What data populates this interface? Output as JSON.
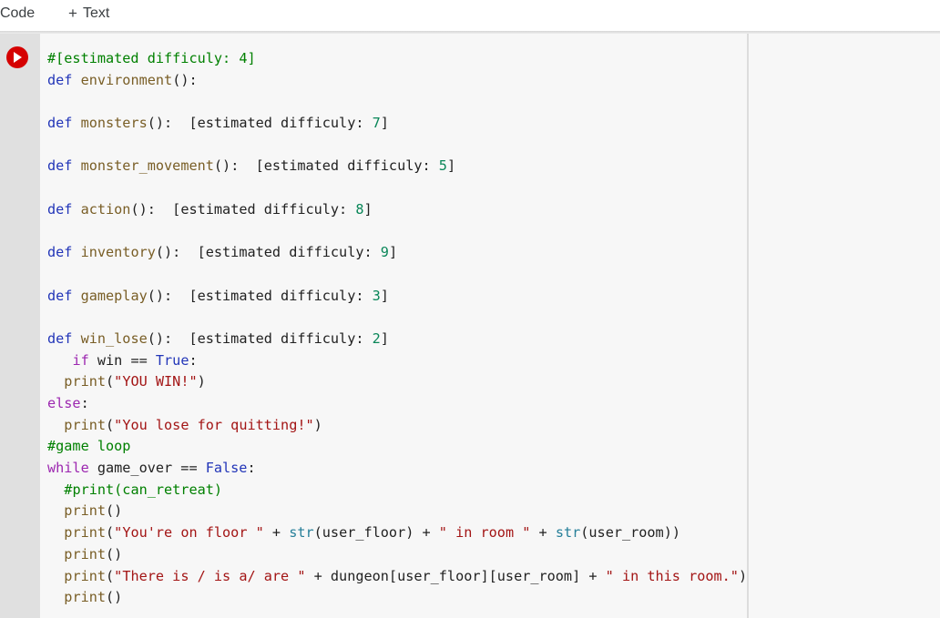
{
  "toolbar": {
    "code_label": "Code",
    "code_icon": "plus-icon",
    "text_label": "Text",
    "text_plus": "+",
    "code_plus": "+"
  },
  "cell": {
    "run_icon": "play-icon",
    "lines": [
      [
        {
          "t": "#[estimated difficuly: ",
          "c": "cm"
        },
        {
          "t": "4",
          "c": "cm"
        },
        {
          "t": "]",
          "c": "cm"
        }
      ],
      [
        {
          "t": "def",
          "c": "kw"
        },
        {
          "t": " ",
          "c": "pl"
        },
        {
          "t": "environment",
          "c": "fn"
        },
        {
          "t": "():",
          "c": "pl"
        }
      ],
      [],
      [
        {
          "t": "def",
          "c": "kw"
        },
        {
          "t": " ",
          "c": "pl"
        },
        {
          "t": "monsters",
          "c": "fn"
        },
        {
          "t": "():  [estimated difficuly: ",
          "c": "pl"
        },
        {
          "t": "7",
          "c": "num"
        },
        {
          "t": "]",
          "c": "pl"
        }
      ],
      [],
      [
        {
          "t": "def",
          "c": "kw"
        },
        {
          "t": " ",
          "c": "pl"
        },
        {
          "t": "monster_movement",
          "c": "fn"
        },
        {
          "t": "():  [estimated difficuly: ",
          "c": "pl"
        },
        {
          "t": "5",
          "c": "num"
        },
        {
          "t": "]",
          "c": "pl"
        }
      ],
      [],
      [
        {
          "t": "def",
          "c": "kw"
        },
        {
          "t": " ",
          "c": "pl"
        },
        {
          "t": "action",
          "c": "fn"
        },
        {
          "t": "():  [estimated difficuly: ",
          "c": "pl"
        },
        {
          "t": "8",
          "c": "num"
        },
        {
          "t": "]",
          "c": "pl"
        }
      ],
      [],
      [
        {
          "t": "def",
          "c": "kw"
        },
        {
          "t": " ",
          "c": "pl"
        },
        {
          "t": "inventory",
          "c": "fn"
        },
        {
          "t": "():  [estimated difficuly: ",
          "c": "pl"
        },
        {
          "t": "9",
          "c": "num"
        },
        {
          "t": "]",
          "c": "pl"
        }
      ],
      [],
      [
        {
          "t": "def",
          "c": "kw"
        },
        {
          "t": " ",
          "c": "pl"
        },
        {
          "t": "gameplay",
          "c": "fn"
        },
        {
          "t": "():  [estimated difficuly: ",
          "c": "pl"
        },
        {
          "t": "3",
          "c": "num"
        },
        {
          "t": "]",
          "c": "pl"
        }
      ],
      [],
      [
        {
          "t": "def",
          "c": "kw"
        },
        {
          "t": " ",
          "c": "pl"
        },
        {
          "t": "win_lose",
          "c": "fn"
        },
        {
          "t": "():  [estimated difficuly: ",
          "c": "pl"
        },
        {
          "t": "2",
          "c": "num"
        },
        {
          "t": "]",
          "c": "pl"
        }
      ],
      [
        {
          "t": "   ",
          "c": "pl"
        },
        {
          "t": "if",
          "c": "kw2"
        },
        {
          "t": " win == ",
          "c": "pl"
        },
        {
          "t": "True",
          "c": "kw"
        },
        {
          "t": ":",
          "c": "pl"
        }
      ],
      [
        {
          "t": "  ",
          "c": "pl"
        },
        {
          "t": "print",
          "c": "fn"
        },
        {
          "t": "(",
          "c": "pl"
        },
        {
          "t": "\"YOU WIN!\"",
          "c": "str"
        },
        {
          "t": ")",
          "c": "pl"
        }
      ],
      [
        {
          "t": "else",
          "c": "kw2"
        },
        {
          "t": ":",
          "c": "pl"
        }
      ],
      [
        {
          "t": "  ",
          "c": "pl"
        },
        {
          "t": "print",
          "c": "fn"
        },
        {
          "t": "(",
          "c": "pl"
        },
        {
          "t": "\"You lose for quitting!\"",
          "c": "str"
        },
        {
          "t": ")",
          "c": "pl"
        }
      ],
      [
        {
          "t": "#game loop",
          "c": "cm"
        }
      ],
      [
        {
          "t": "while",
          "c": "kw2"
        },
        {
          "t": " game_over == ",
          "c": "pl"
        },
        {
          "t": "False",
          "c": "kw"
        },
        {
          "t": ":",
          "c": "pl"
        }
      ],
      [
        {
          "t": "  ",
          "c": "pl"
        },
        {
          "t": "#print(can_retreat)",
          "c": "cm"
        }
      ],
      [
        {
          "t": "  ",
          "c": "pl"
        },
        {
          "t": "print",
          "c": "fn"
        },
        {
          "t": "()",
          "c": "pl"
        }
      ],
      [
        {
          "t": "  ",
          "c": "pl"
        },
        {
          "t": "print",
          "c": "fn"
        },
        {
          "t": "(",
          "c": "pl"
        },
        {
          "t": "\"You're on floor \"",
          "c": "str"
        },
        {
          "t": " + ",
          "c": "pl"
        },
        {
          "t": "str",
          "c": "bi"
        },
        {
          "t": "(user_floor) + ",
          "c": "pl"
        },
        {
          "t": "\" in room \"",
          "c": "str"
        },
        {
          "t": " + ",
          "c": "pl"
        },
        {
          "t": "str",
          "c": "bi"
        },
        {
          "t": "(user_room))",
          "c": "pl"
        }
      ],
      [
        {
          "t": "  ",
          "c": "pl"
        },
        {
          "t": "print",
          "c": "fn"
        },
        {
          "t": "()",
          "c": "pl"
        }
      ],
      [
        {
          "t": "  ",
          "c": "pl"
        },
        {
          "t": "print",
          "c": "fn"
        },
        {
          "t": "(",
          "c": "pl"
        },
        {
          "t": "\"There is / is a/ are \"",
          "c": "str"
        },
        {
          "t": " + dungeon[user_floor][user_room] + ",
          "c": "pl"
        },
        {
          "t": "\" in this room.\"",
          "c": "str"
        },
        {
          "t": ")",
          "c": "pl"
        }
      ],
      [
        {
          "t": "  ",
          "c": "pl"
        },
        {
          "t": "print",
          "c": "fn"
        },
        {
          "t": "()",
          "c": "pl"
        }
      ]
    ]
  }
}
